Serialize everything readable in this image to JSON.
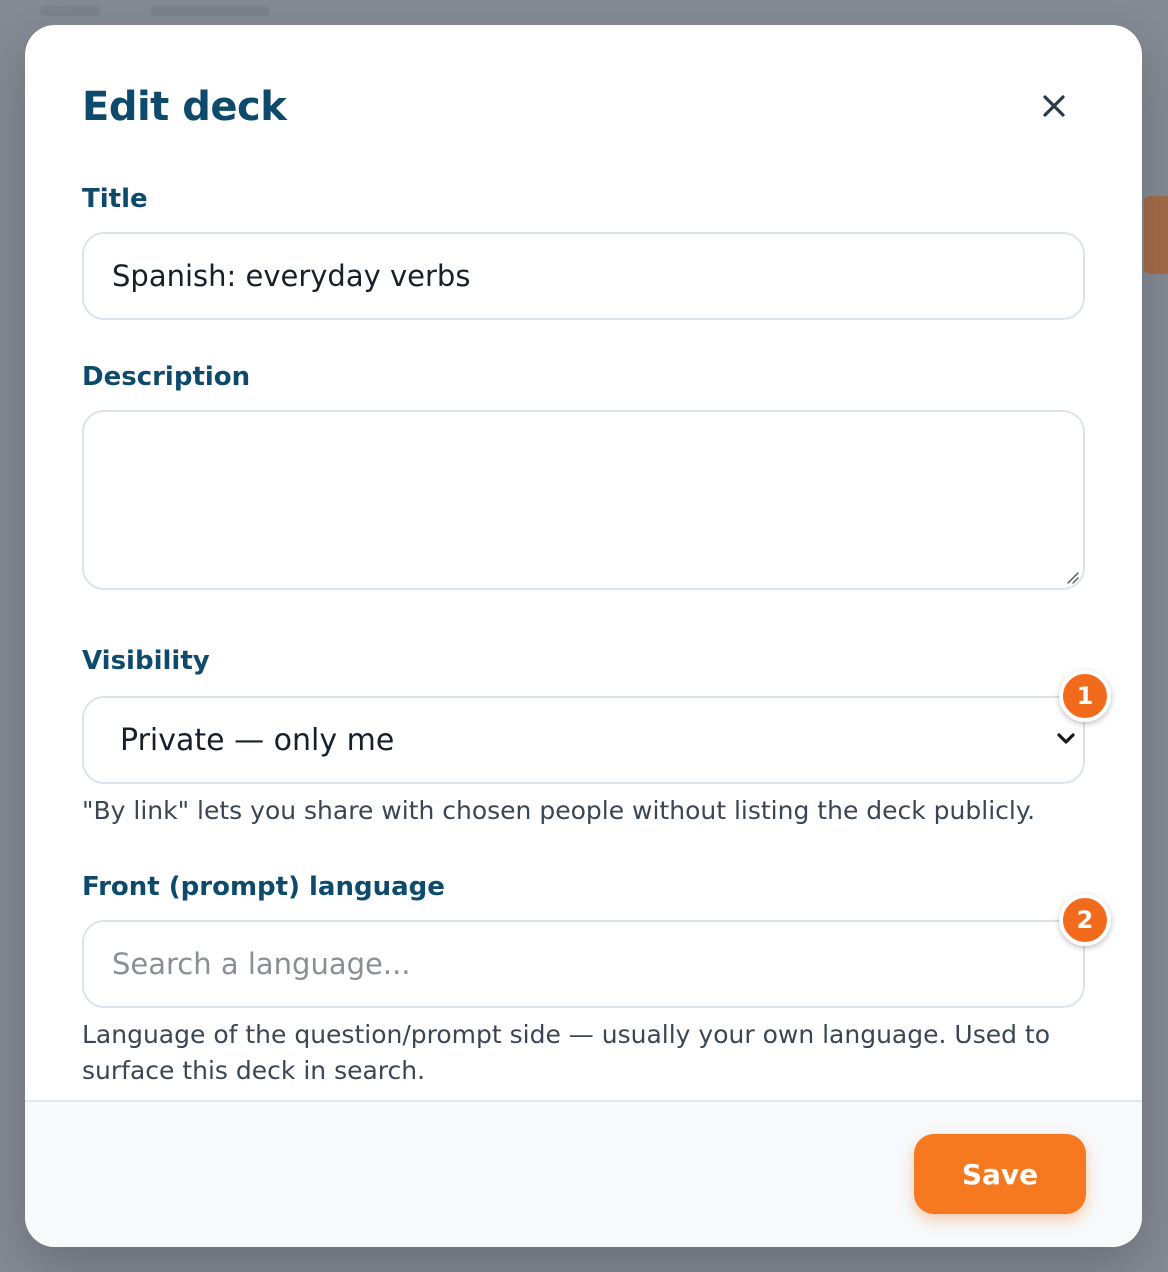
{
  "modal": {
    "title": "Edit deck",
    "close_icon": "close-icon"
  },
  "fields": {
    "title": {
      "label": "Title",
      "value": "Spanish: everyday verbs"
    },
    "description": {
      "label": "Description",
      "value": ""
    },
    "visibility": {
      "label": "Visibility",
      "selected": "Private — only me",
      "help": "\"By link\" lets you share with chosen people without listing the deck publicly.",
      "badge": "1"
    },
    "front_language": {
      "label": "Front (prompt) language",
      "placeholder": "Search a language...",
      "help_line1": "Language of the question/prompt side — usually your own language. Used to",
      "help_line2": "surface this deck in search.",
      "badge": "2"
    }
  },
  "footer": {
    "save_label": "Save"
  },
  "colors": {
    "heading": "#0e4a6b",
    "accent": "#f7791f",
    "badge": "#f26b1d"
  }
}
